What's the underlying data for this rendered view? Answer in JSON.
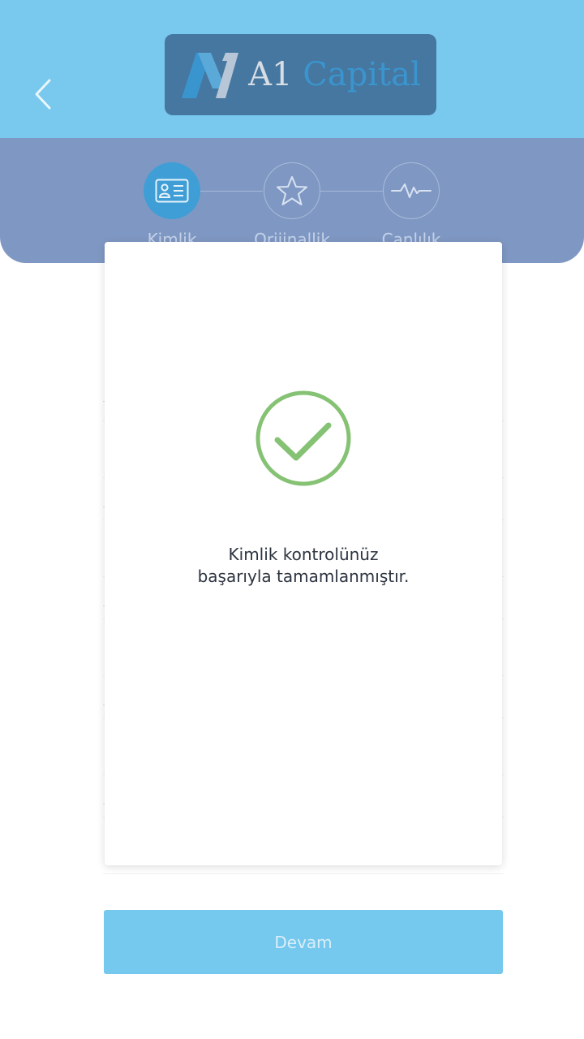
{
  "header": {
    "logo": {
      "text_a1": "A1",
      "text_capital": "Capital"
    }
  },
  "stepper": {
    "steps": [
      {
        "label": "Kimlik",
        "icon": "id-card-icon",
        "active": true
      },
      {
        "label": "Orijinallik",
        "icon": "star-icon",
        "active": false
      },
      {
        "label": "Canlılık",
        "icon": "pulse-icon",
        "active": false
      }
    ]
  },
  "dialog": {
    "icon": "success-check-icon",
    "message_line1": "Kimlik kontrolünüz",
    "message_line2": "başarıyla tamamlanmıştır."
  },
  "footer": {
    "continue_label": "Devam"
  },
  "colors": {
    "header_bg": "#79c8ee",
    "stepper_bg": "#7f98c3",
    "active_step": "#3f9ed6",
    "success_green": "#86c274",
    "button_bg": "#75c8ee"
  }
}
